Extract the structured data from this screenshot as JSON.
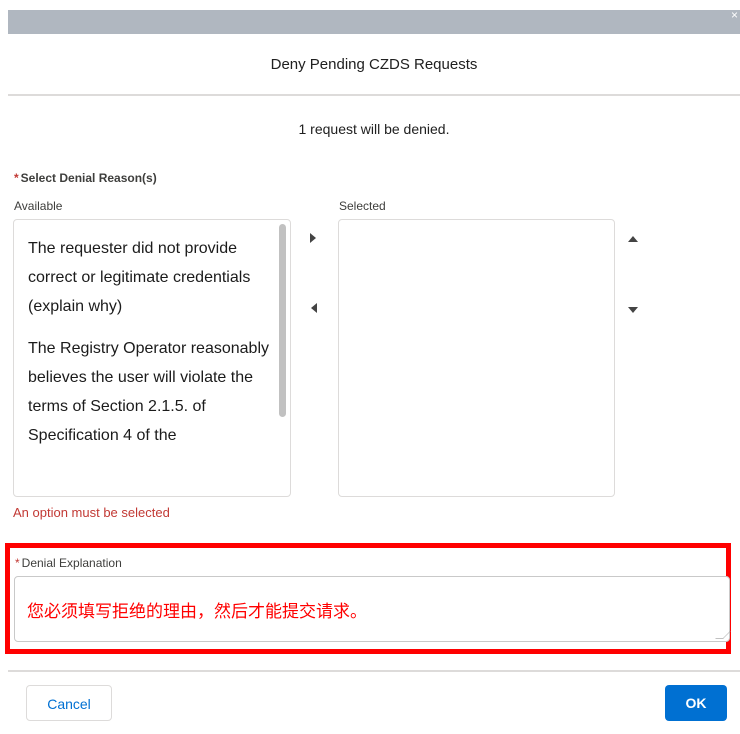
{
  "modal": {
    "close_icon_glyph": "×",
    "title": "Deny Pending CZDS Requests",
    "summary": "1 request will be denied."
  },
  "denial_reasons": {
    "required_marker": "*",
    "label": "Select Denial Reason(s)",
    "available_label": "Available",
    "selected_label": "Selected",
    "available_options": [
      "The requester did not provide correct or legitimate credentials (explain why)",
      "The Registry Operator reasonably believes the user will violate the terms of Section 2.1.5. of Specification 4 of the"
    ],
    "selected_options": [],
    "error": "An option must be selected",
    "icons": {
      "move_right": "caret-right-icon",
      "move_left": "caret-left-icon",
      "move_up": "caret-up-icon",
      "move_down": "caret-down-icon"
    }
  },
  "denial_explanation": {
    "required_marker": "*",
    "label": "Denial Explanation",
    "value": "您必须填写拒绝的理由，然后才能提交请求。"
  },
  "footer": {
    "cancel_label": "Cancel",
    "ok_label": "OK"
  },
  "colors": {
    "accent": "#0070d2",
    "error": "#c23934",
    "highlight": "#ff0000"
  }
}
